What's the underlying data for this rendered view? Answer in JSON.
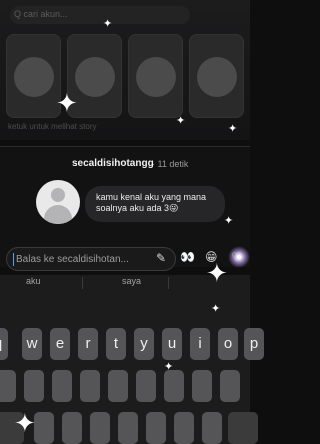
{
  "background": {
    "search_placeholder": "Q  cari akun...",
    "footer_hint": "ketuk untuk melihat story"
  },
  "message": {
    "sender": "secaldisihotangg",
    "time": "· 11 detik",
    "text": "kamu kenal aku yang mana soalnya aku ada 3😜"
  },
  "input": {
    "placeholder": "Balas ke secaldisihotan...",
    "pencil_icon": "✎",
    "eyes_icon": "👀",
    "emoji_icon": "😁",
    "heart_icon": "♡"
  },
  "keyboard": {
    "suggestions": [
      "aku",
      "saya"
    ],
    "row1": [
      "q",
      "w",
      "e",
      "r",
      "t",
      "y",
      "u",
      "i",
      "o",
      "p"
    ]
  }
}
